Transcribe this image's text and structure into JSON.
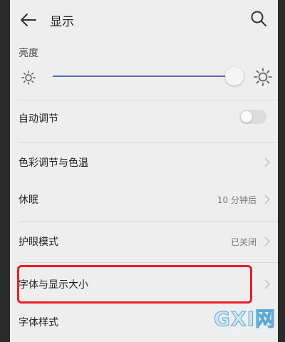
{
  "header": {
    "back_icon": "arrow-left-icon",
    "title": "显示",
    "search_icon": "search-icon"
  },
  "brightness": {
    "label": "亮度",
    "level": 0.92,
    "low_icon": "sun-small-icon",
    "high_icon": "sun-large-icon",
    "accent_color": "#5b67b8"
  },
  "auto_adjust": {
    "label": "自动调节",
    "enabled": false
  },
  "items": [
    {
      "label": "色彩调节与色温",
      "value": ""
    },
    {
      "label": "休眠",
      "value": "10 分钟后"
    },
    {
      "label": "护眼模式",
      "value": "已关闭"
    },
    {
      "label": "字体与显示大小",
      "value": ""
    },
    {
      "label": "字体样式",
      "value": ""
    }
  ],
  "highlight_color": "#ee1c25",
  "watermark": {
    "main": "GXI网",
    "sub": "system.com"
  }
}
